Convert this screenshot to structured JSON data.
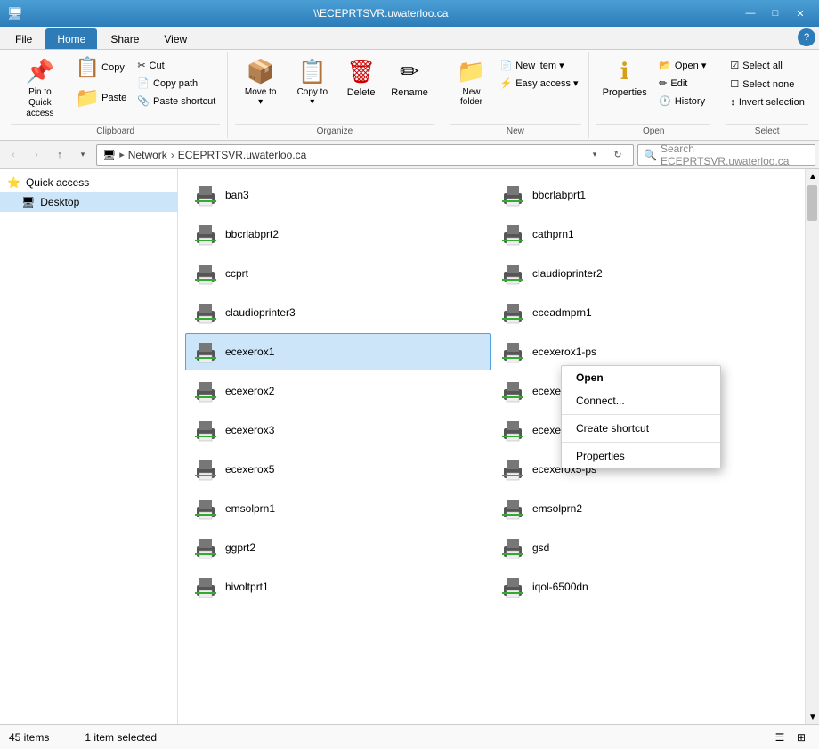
{
  "titleBar": {
    "icon": "🖥",
    "title": "\\\\ECEPRTSVR.uwaterloo.ca",
    "minimize": "—",
    "maximize": "□",
    "close": "✕"
  },
  "tabs": [
    {
      "id": "file",
      "label": "File",
      "active": false
    },
    {
      "id": "home",
      "label": "Home",
      "active": true
    },
    {
      "id": "share",
      "label": "Share",
      "active": false
    },
    {
      "id": "view",
      "label": "View",
      "active": false
    }
  ],
  "ribbon": {
    "groups": [
      {
        "id": "clipboard",
        "label": "Clipboard",
        "buttons": [
          {
            "id": "pin",
            "icon": "📌",
            "label": "Pin to Quick\naccess",
            "large": true
          },
          {
            "id": "copy",
            "icon": "📋",
            "label": "Copy",
            "large": true
          },
          {
            "id": "paste",
            "icon": "📁",
            "label": "Paste",
            "large": true
          }
        ],
        "smallButtons": [
          {
            "id": "cut",
            "icon": "✂",
            "label": "Cut"
          },
          {
            "id": "copy-path",
            "icon": "📄",
            "label": "Copy path"
          },
          {
            "id": "paste-shortcut",
            "icon": "📎",
            "label": "Paste shortcut"
          }
        ]
      },
      {
        "id": "organize",
        "label": "Organize",
        "buttons": [
          {
            "id": "move-to",
            "icon": "📦",
            "label": "Move\nto ▾",
            "large": true
          },
          {
            "id": "copy-to",
            "icon": "📋",
            "label": "Copy\nto ▾",
            "large": true
          },
          {
            "id": "delete",
            "icon": "🗑",
            "label": "Delete",
            "large": true
          },
          {
            "id": "rename",
            "icon": "✏",
            "label": "Rename",
            "large": true
          }
        ]
      },
      {
        "id": "new",
        "label": "New",
        "buttons": [
          {
            "id": "new-folder",
            "icon": "📁",
            "label": "New\nfolder",
            "large": true
          }
        ],
        "smallButtons": [
          {
            "id": "new-item",
            "icon": "📄",
            "label": "New item ▾"
          },
          {
            "id": "easy-access",
            "icon": "⚡",
            "label": "Easy access ▾"
          }
        ]
      },
      {
        "id": "open",
        "label": "Open",
        "buttons": [
          {
            "id": "properties",
            "icon": "ℹ",
            "label": "Properties",
            "large": true
          }
        ],
        "smallButtons": [
          {
            "id": "open",
            "icon": "📂",
            "label": "Open ▾"
          },
          {
            "id": "edit",
            "icon": "✏",
            "label": "Edit"
          },
          {
            "id": "history",
            "icon": "🕐",
            "label": "History"
          }
        ]
      },
      {
        "id": "select",
        "label": "Select",
        "smallButtons": [
          {
            "id": "select-all",
            "icon": "☑",
            "label": "Select all"
          },
          {
            "id": "select-none",
            "icon": "☐",
            "label": "Select none"
          },
          {
            "id": "invert-selection",
            "icon": "↕",
            "label": "Invert selection"
          }
        ]
      }
    ]
  },
  "nav": {
    "back": "‹",
    "forward": "›",
    "up": "↑",
    "refresh": "↻",
    "addressPath": [
      "Network",
      "ECEPRTSVR.uwaterloo.ca"
    ],
    "searchPlaceholder": "Search ECEPRTSVR.uwaterloo.ca"
  },
  "sidebar": {
    "items": [
      {
        "id": "quick-access",
        "icon": "⭐",
        "label": "Quick access",
        "expanded": true
      },
      {
        "id": "desktop",
        "icon": "🖥",
        "label": "Desktop",
        "selected": true
      }
    ]
  },
  "files": [
    {
      "id": "ban3",
      "name": "ban3"
    },
    {
      "id": "bbcrlabprt1",
      "name": "bbcrlabprt1"
    },
    {
      "id": "bbcrlabprt2",
      "name": "bbcrlabprt2"
    },
    {
      "id": "cathprn1",
      "name": "cathprn1"
    },
    {
      "id": "ccprt",
      "name": "ccprt"
    },
    {
      "id": "claudioprinter2",
      "name": "claudioprinter2"
    },
    {
      "id": "claudioprinter3",
      "name": "claudioprinter3"
    },
    {
      "id": "eceadmprn1",
      "name": "eceadmprn1"
    },
    {
      "id": "ecexerox1",
      "name": "ecexerox1",
      "selected": true
    },
    {
      "id": "ecexerox1-ps",
      "name": "ecexerox1-ps"
    },
    {
      "id": "ecexerox2",
      "name": "ecexerox2"
    },
    {
      "id": "ecexerox3-ps",
      "name": "ecexerox3-ps"
    },
    {
      "id": "ecexerox3",
      "name": "ecexerox3"
    },
    {
      "id": "ecexerox4",
      "name": "ecexerox4"
    },
    {
      "id": "ecexerox5",
      "name": "ecexerox5"
    },
    {
      "id": "ecexerox5-ps",
      "name": "ecexerox5-ps"
    },
    {
      "id": "emsolprn1",
      "name": "emsolprn1"
    },
    {
      "id": "emsolprn2",
      "name": "emsolprn2"
    },
    {
      "id": "ggprt2",
      "name": "ggprt2"
    },
    {
      "id": "gsd",
      "name": "gsd"
    },
    {
      "id": "hivoltprt1",
      "name": "hivoltprt1"
    },
    {
      "id": "iqol-6500dn",
      "name": "iqol-6500dn"
    }
  ],
  "contextMenu": {
    "items": [
      {
        "id": "open",
        "label": "Open",
        "bold": true
      },
      {
        "id": "connect",
        "label": "Connect..."
      },
      {
        "separator": true
      },
      {
        "id": "create-shortcut",
        "label": "Create shortcut"
      },
      {
        "separator": true
      },
      {
        "id": "properties",
        "label": "Properties"
      }
    ]
  },
  "statusBar": {
    "itemCount": "45 items",
    "selectedCount": "1 item selected"
  }
}
